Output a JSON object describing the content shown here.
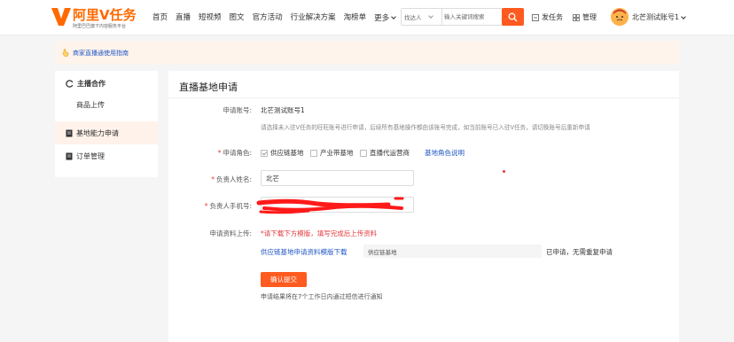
{
  "header": {
    "logo_title": "阿里V任务",
    "logo_subtitle": "阿里巴巴旗下内容服务平台",
    "nav": [
      "首页",
      "直播",
      "短视频",
      "图文",
      "官方活动",
      "行业解决方案",
      "淘榜单"
    ],
    "nav_more": "更多",
    "search_scope": "找达人",
    "search_placeholder": "输入关键词搜索",
    "publish_task": "发任务",
    "manage": "管理",
    "user_name": "北芒测试账号1"
  },
  "notice": {
    "text": "商家直播通使用指南"
  },
  "sidebar": {
    "group_label": "主播合作",
    "sub_item": "商品上传",
    "items": [
      {
        "label": "基地能力申请",
        "active": true
      },
      {
        "label": "订单管理",
        "active": false
      }
    ]
  },
  "form": {
    "title": "直播基地申请",
    "account_label": "申请账号:",
    "account_value": "北芒测试账号1",
    "account_hint": "请选择未入驻V任务的旺旺账号进行申请，后续所有基地操作都由该账号完成，如当前账号已入驻V任务，请切换账号后重新申请",
    "role_label": "申请角色:",
    "roles": [
      {
        "label": "供应链基地",
        "checked": true
      },
      {
        "label": "产业带基地",
        "checked": false
      },
      {
        "label": "直播代运营商",
        "checked": false
      }
    ],
    "role_help": "基地角色说明",
    "name_label": "负责人姓名:",
    "name_value": "北芒",
    "phone_label": "负责人手机号:",
    "upload_label": "申请资料上传:",
    "upload_warning": "*请下载下方模版，填写完成后上传资料",
    "template_link": "供应链基地申请资料模版下载",
    "uploaded_file": "供应链基地",
    "uploaded_status": "已申请，无需重复申请",
    "submit_label": "确认提交",
    "footer_note": "申请结果将在7个工作日内通过短信进行通知"
  },
  "colors": {
    "brand": "#ff6a00",
    "accent": "#ff5a1f",
    "link": "#1f56c4",
    "required": "#e4393c"
  }
}
